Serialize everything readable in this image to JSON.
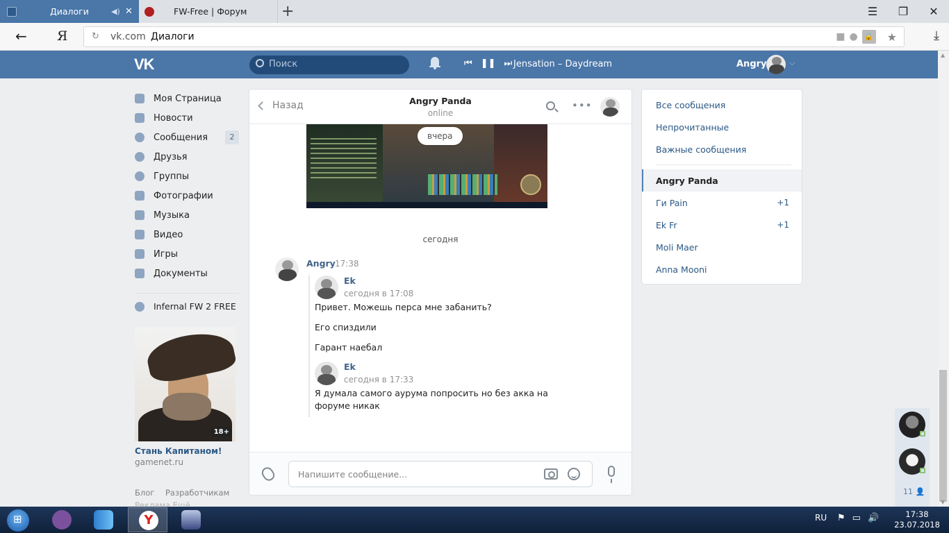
{
  "browser": {
    "tabs": [
      {
        "title": "Диалоги",
        "active": true
      },
      {
        "title": "FW-Free | Форум",
        "active": false
      }
    ],
    "new_tab": "+",
    "window_buttons": [
      "☰",
      "❐",
      "✕"
    ],
    "back": "←",
    "yandex_logo": "Я",
    "reload": "↻",
    "domain": "vk.com",
    "page_title": "Диалоги"
  },
  "vk_header": {
    "logo": "VK",
    "search_placeholder": "Поиск",
    "player": {
      "prev": "⏮",
      "pause": "❚❚",
      "next": "⏭",
      "track": "Jensation – Daydream"
    },
    "user_name": "Angry"
  },
  "left_nav": {
    "items": [
      {
        "label": "Моя Страница",
        "icon": "home-icon"
      },
      {
        "label": "Новости",
        "icon": "news-icon"
      },
      {
        "label": "Сообщения",
        "icon": "messages-icon",
        "count": "2"
      },
      {
        "label": "Друзья",
        "icon": "friends-icon"
      },
      {
        "label": "Группы",
        "icon": "groups-icon"
      },
      {
        "label": "Фотографии",
        "icon": "camera-icon"
      },
      {
        "label": "Музыка",
        "icon": "music-icon"
      },
      {
        "label": "Видео",
        "icon": "video-icon"
      },
      {
        "label": "Игры",
        "icon": "games-icon"
      },
      {
        "label": "Документы",
        "icon": "documents-icon"
      }
    ],
    "group": "Infernal FW 2 FREE",
    "ad": {
      "age": "18+",
      "title": "Стань Капитаном!",
      "site": "gamenet.ru"
    },
    "footer": [
      "Блог",
      "Разработчикам"
    ],
    "footer2": "Реклама  Ещё"
  },
  "chat": {
    "back_label": "Назад",
    "name": "Angry Panda",
    "status": "online",
    "date_pill": "вчера",
    "divider": "сегодня",
    "message": {
      "author": "Angry",
      "time": "17:38",
      "forwards": [
        {
          "name": "Ek",
          "date": "сегодня в 17:08",
          "lines": [
            "Привет. Можешь перса мне забанить?",
            "Его спиздили",
            "Гарант наебал"
          ]
        },
        {
          "name": "Ek",
          "date": "сегодня в 17:33",
          "lines": [
            "Я думала самого аурума попросить но без акка на форуме никак"
          ]
        }
      ]
    },
    "input_placeholder": "Напишите сообщение..."
  },
  "right_panel": {
    "filters": [
      "Все сообщения",
      "Непрочитанные",
      "Важные сообщения"
    ],
    "conversations": [
      {
        "name": "Angry Panda",
        "selected": true,
        "count": ""
      },
      {
        "name": "Ги Pain",
        "selected": false,
        "count": "+1"
      },
      {
        "name": "Ek Fr",
        "selected": false,
        "count": "+1"
      },
      {
        "name": "Moli Maer",
        "selected": false,
        "count": ""
      },
      {
        "name": "Anna Mooni",
        "selected": false,
        "count": ""
      }
    ]
  },
  "friends_bar": {
    "online_count": "11"
  },
  "taskbar": {
    "lang": "RU",
    "time": "17:38",
    "date": "23.07.2018"
  },
  "colors": {
    "vk_blue": "#4a76a8",
    "link": "#2a5885",
    "background": "#edeef0"
  }
}
